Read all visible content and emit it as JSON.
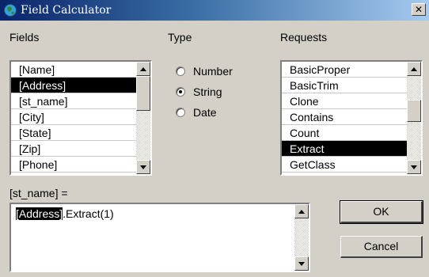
{
  "window": {
    "title": "Field Calculator",
    "close_label": "✕"
  },
  "fields": {
    "label": "Fields",
    "items": [
      "[Name]",
      "[Address]",
      "[st_name]",
      "[City]",
      "[State]",
      "[Zip]",
      "[Phone]"
    ],
    "selected_index": 1
  },
  "type": {
    "label": "Type",
    "options": [
      "Number",
      "String",
      "Date"
    ],
    "selected": "String"
  },
  "requests": {
    "label": "Requests",
    "items": [
      "BasicProper",
      "BasicTrim",
      "Clone",
      "Contains",
      "Count",
      "Extract",
      "GetClass"
    ],
    "selected_index": 5
  },
  "expression": {
    "target_label": "[st_name] =",
    "field": "[Address]",
    "rest": ".Extract(1)"
  },
  "buttons": {
    "ok": "OK",
    "cancel": "Cancel"
  },
  "colors": {
    "titlebar": "#0a246a",
    "face": "#d4d0c8",
    "selection": "#000000"
  }
}
